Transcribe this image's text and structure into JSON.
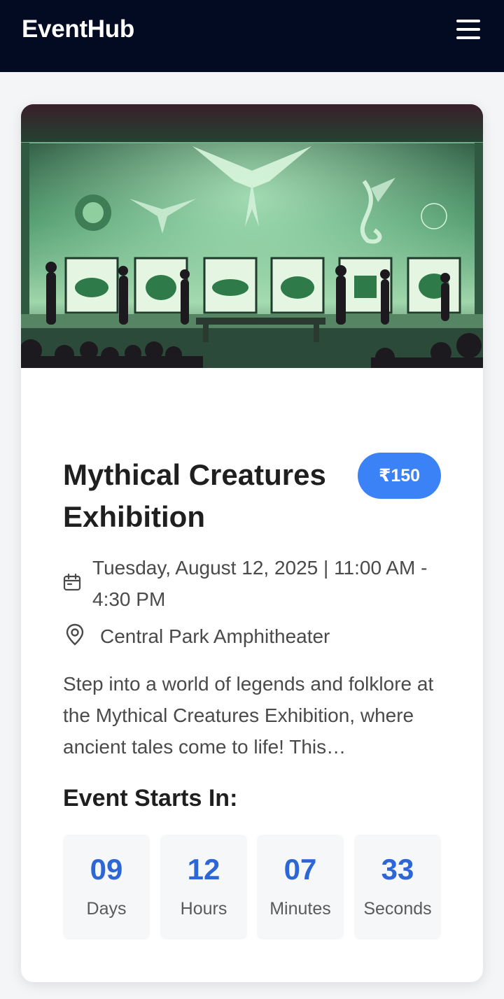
{
  "header": {
    "brand": "EventHub",
    "menu_icon": "hamburger-menu-icon"
  },
  "event": {
    "title": "Mythical Creatures Exhibition",
    "price": "₹150",
    "date_time": "Tuesday, August 12, 2025 | 11:00 AM - 4:30 PM",
    "date_icon": "calendar-icon",
    "location": "Central Park Amphitheater",
    "location_icon": "location-pin-icon",
    "description": "Step into a world of legends and folklore at the Mythical Creatures Exhibition, where ancient tales come to life! This…"
  },
  "countdown": {
    "title": "Event Starts In:",
    "units": [
      {
        "value": "09",
        "label": "Days"
      },
      {
        "value": "12",
        "label": "Hours"
      },
      {
        "value": "07",
        "label": "Minutes"
      },
      {
        "value": "33",
        "label": "Seconds"
      }
    ]
  },
  "colors": {
    "navbar": "#020b22",
    "price_badge": "#3b82f6",
    "countdown_number": "#2d67d6"
  }
}
